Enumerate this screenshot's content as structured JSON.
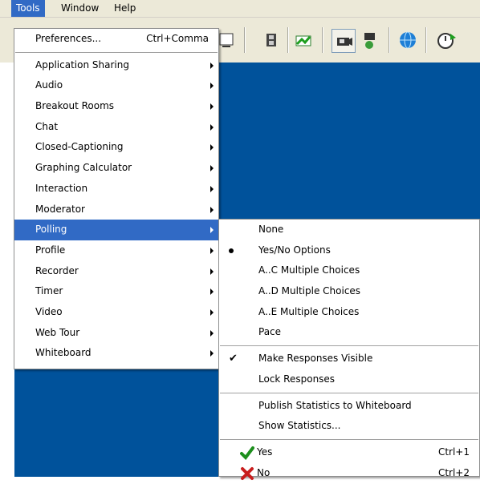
{
  "menubar": {
    "items": [
      {
        "label": "Tools",
        "active": true
      },
      {
        "label": "Window",
        "active": false
      },
      {
        "label": "Help",
        "active": false
      }
    ]
  },
  "tools_menu": {
    "preferences": {
      "label": "Preferences...",
      "shortcut": "Ctrl+Comma"
    },
    "items": [
      {
        "label": "Application Sharing"
      },
      {
        "label": "Audio"
      },
      {
        "label": "Breakout Rooms"
      },
      {
        "label": "Chat"
      },
      {
        "label": "Closed-Captioning"
      },
      {
        "label": "Graphing Calculator"
      },
      {
        "label": "Interaction"
      },
      {
        "label": "Moderator"
      },
      {
        "label": "Polling"
      },
      {
        "label": "Profile"
      },
      {
        "label": "Recorder"
      },
      {
        "label": "Timer"
      },
      {
        "label": "Video"
      },
      {
        "label": "Web Tour"
      },
      {
        "label": "Whiteboard"
      }
    ],
    "highlighted": "Polling"
  },
  "polling_menu": {
    "group1": [
      {
        "label": "None",
        "mark": ""
      },
      {
        "label": "Yes/No Options",
        "mark": "bullet"
      },
      {
        "label": "A..C Multiple Choices",
        "mark": ""
      },
      {
        "label": "A..D Multiple Choices",
        "mark": ""
      },
      {
        "label": "A..E Multiple Choices",
        "mark": ""
      },
      {
        "label": "Pace",
        "mark": ""
      }
    ],
    "group2": [
      {
        "label": "Make Responses Visible",
        "mark": "check"
      },
      {
        "label": "Lock Responses",
        "mark": ""
      }
    ],
    "group3": [
      {
        "label": "Publish Statistics to Whiteboard"
      },
      {
        "label": "Show Statistics..."
      }
    ],
    "group4": [
      {
        "label": "Yes",
        "shortcut": "Ctrl+1",
        "icon": "green-check-icon"
      },
      {
        "label": "No",
        "shortcut": "Ctrl+2",
        "icon": "red-x-icon"
      }
    ],
    "check_glyph": "✔"
  },
  "colors": {
    "highlight": "#316ac5",
    "workspace_blue": "#00529b",
    "menubar_bg": "#ece9d8"
  }
}
